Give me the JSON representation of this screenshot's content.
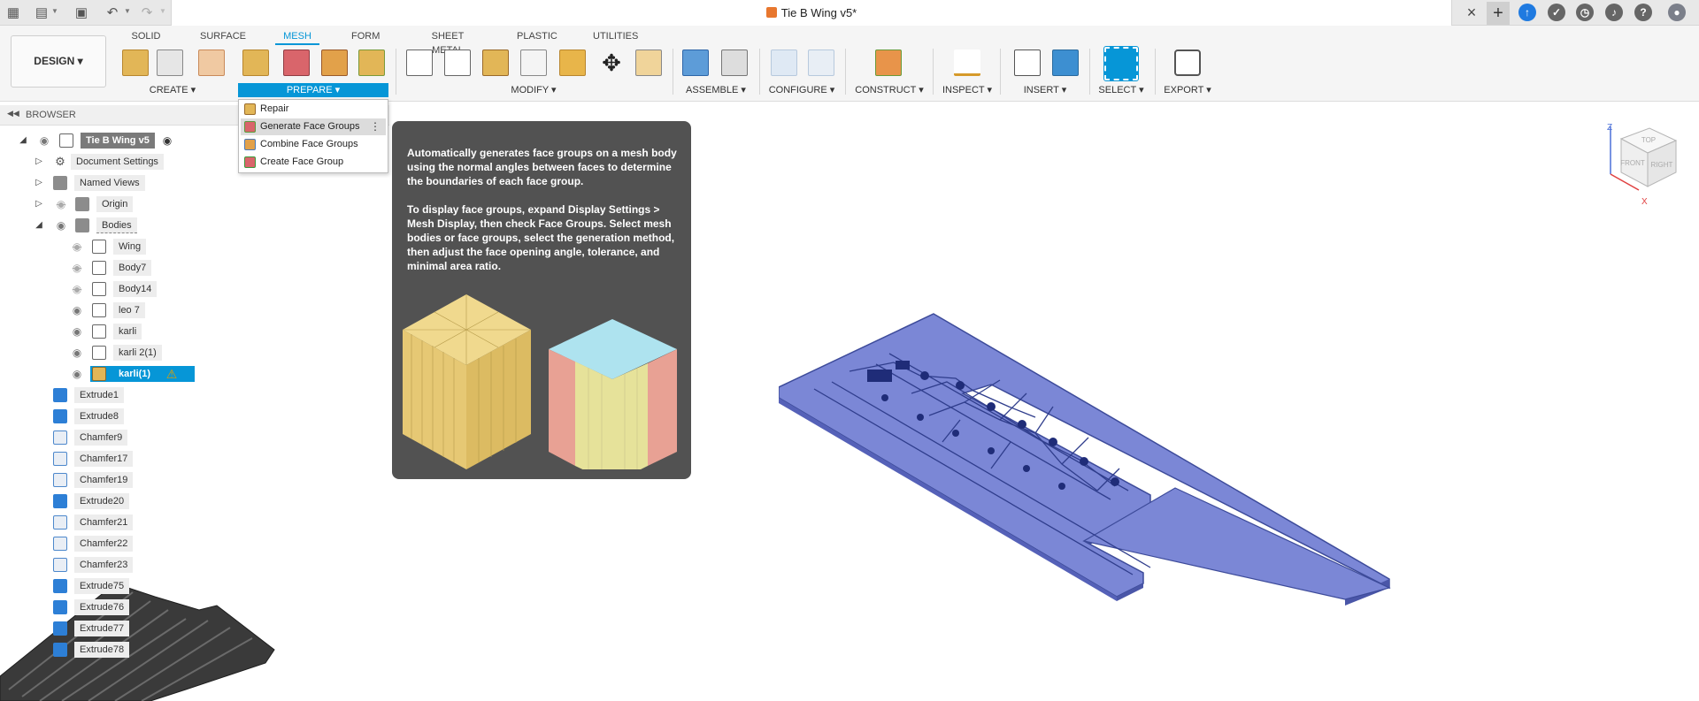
{
  "titlebar": {
    "document_title": "Tie B Wing v5*"
  },
  "toolbar": {
    "workspace_button": "DESIGN",
    "tabs": [
      "SOLID",
      "SURFACE",
      "MESH",
      "FORM",
      "SHEET METAL",
      "PLASTIC",
      "UTILITIES"
    ],
    "active_tab": "MESH",
    "groups": [
      "CREATE",
      "PREPARE",
      "MODIFY",
      "ASSEMBLE",
      "CONFIGURE",
      "CONSTRUCT",
      "INSPECT",
      "INSERT",
      "SELECT",
      "EXPORT"
    ],
    "dropdown_caret": "▾"
  },
  "browser": {
    "title": "BROWSER",
    "root": "Tie B Wing v5",
    "items": {
      "document_settings": "Document Settings",
      "named_views": "Named Views",
      "origin": "Origin",
      "bodies": "Bodies"
    },
    "bodies": [
      "Wing",
      "Body7",
      "Body14",
      "leo 7",
      "karli",
      "karli 2(1)",
      "karli(1)"
    ],
    "features": [
      "Extrude1",
      "Extrude8",
      "Chamfer9",
      "Chamfer17",
      "Chamfer19",
      "Extrude20",
      "Chamfer21",
      "Chamfer22",
      "Chamfer23",
      "Extrude75",
      "Extrude76",
      "Extrude77",
      "Extrude78"
    ]
  },
  "prepare_menu": {
    "items": [
      "Repair",
      "Generate Face Groups",
      "Combine Face Groups",
      "Create Face Group"
    ],
    "highlighted": "Generate Face Groups",
    "more_glyph": "⋮"
  },
  "tooltip": {
    "paragraph_1": "Automatically generates face groups on a mesh body using the normal angles between faces to determine the boundaries of each face group.",
    "paragraph_2": "To display face groups, expand Display Settings > Mesh Display, then check Face Groups. Select mesh bodies or face groups, select the generation method, then adjust the face opening angle, tolerance, and minimal area ratio."
  },
  "viewcube": {
    "faces": [
      "TOP",
      "FRONT",
      "RIGHT"
    ],
    "axes": [
      "Z",
      "X"
    ]
  },
  "colors": {
    "accent": "#0696d7",
    "model_fill": "#7b87d6",
    "tooltip_bg": "#525252"
  }
}
